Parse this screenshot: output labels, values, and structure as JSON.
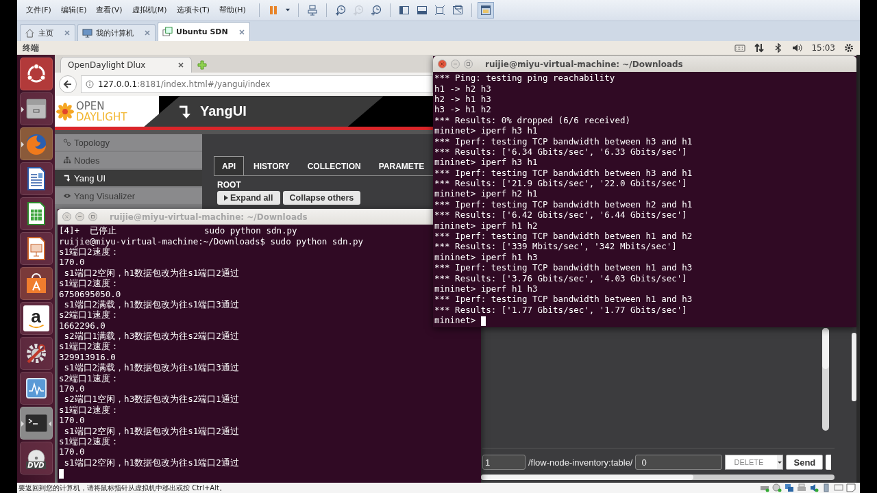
{
  "menu": [
    "文件(F)",
    "编辑(E)",
    "查看(V)",
    "虚拟机(M)",
    "选项卡(T)",
    "帮助(H)"
  ],
  "toolbar_groups": [
    [
      {
        "kind": "pause",
        "pressed": false,
        "disabled": false
      },
      {
        "kind": "caret",
        "pressed": false,
        "disabled": false
      }
    ],
    [
      {
        "kind": "send-keys",
        "pressed": false,
        "disabled": false
      }
    ],
    [
      {
        "kind": "snapshot",
        "pressed": false,
        "disabled": false
      },
      {
        "kind": "snapshot",
        "pressed": false,
        "disabled": true
      },
      {
        "kind": "snapshot",
        "pressed": false,
        "disabled": false
      }
    ],
    [
      {
        "kind": "sidebar-view",
        "pressed": false,
        "disabled": false
      },
      {
        "kind": "console-view",
        "pressed": false,
        "disabled": false
      },
      {
        "kind": "fullscreen",
        "pressed": false,
        "disabled": false
      },
      {
        "kind": "unity",
        "pressed": false,
        "disabled": false
      }
    ],
    [
      {
        "kind": "thumbnail",
        "pressed": true,
        "disabled": false
      }
    ]
  ],
  "vm_tabs": [
    {
      "kind": "home",
      "label": "主页",
      "selected": false
    },
    {
      "kind": "computer",
      "label": "我的计算机",
      "selected": false
    },
    {
      "kind": "vm",
      "label": "Ubuntu SDN",
      "selected": true
    }
  ],
  "top_panel": {
    "app_name": "终端",
    "clock": "15:03"
  },
  "launcher": [
    {
      "kind": "ubuntu",
      "running": false,
      "focused": false
    },
    {
      "kind": "files",
      "running": true,
      "focused": false
    },
    {
      "kind": "firefox",
      "running": true,
      "focused": false
    },
    {
      "kind": "writer",
      "running": false,
      "focused": false
    },
    {
      "kind": "calc",
      "running": false,
      "focused": false
    },
    {
      "kind": "impress",
      "running": false,
      "focused": false
    },
    {
      "kind": "software",
      "running": false,
      "focused": false
    },
    {
      "kind": "amazon",
      "label": "a",
      "running": false,
      "focused": false
    },
    {
      "kind": "settings",
      "running": false,
      "focused": false
    },
    {
      "kind": "monitor",
      "running": false,
      "focused": false
    },
    {
      "kind": "terminal",
      "running": true,
      "focused": true
    },
    {
      "kind": "dvd",
      "label": "DVD",
      "running": false,
      "focused": false
    }
  ],
  "browser": {
    "tab_title": "OpenDaylight Dlux",
    "url_host": "127.0.0.1",
    "url_rest": ":8181/index.html#/yangui/index",
    "logo_top": "OPEN",
    "logo_bottom": "DAYLIGHT",
    "header_title": "YangUI",
    "nav": [
      {
        "kind": "topology",
        "label": "Topology",
        "selected": false
      },
      {
        "kind": "nodes",
        "label": "Nodes",
        "selected": false
      },
      {
        "kind": "yangui",
        "label": "Yang UI",
        "selected": true
      },
      {
        "kind": "visualizer",
        "label": "Yang Visualizer",
        "selected": false
      }
    ],
    "tabs": [
      {
        "label": "API",
        "selected": true
      },
      {
        "label": "HISTORY",
        "selected": false
      },
      {
        "label": "COLLECTION",
        "selected": false
      },
      {
        "label": "PARAMETE",
        "selected": false
      }
    ],
    "root_label": "ROOT",
    "expand_button": "Expand all",
    "collapse_button": "Collapse others",
    "request": {
      "node_value": "1",
      "path_text": "/flow-node-inventory:table/",
      "table_value": "0",
      "method": "DELETE",
      "send_button": "Send"
    }
  },
  "terminals": [
    {
      "title": "ruijie@miyu-virtual-machine: ~/Downloads",
      "focused": false,
      "lines": [
        "[4]+  已停止                 sudo python sdn.py",
        "ruijie@miyu-virtual-machine:~/Downloads$ sudo python sdn.py",
        "s1端口2速度：",
        "170.0",
        " s1端口2空闲，h1数据包改为往s1端口2通过",
        "s1端口2速度：",
        "6750695050.0",
        " s1端口2满载，h1数据包改为往s1端口3通过",
        "s2端口1速度：",
        "1662296.0",
        " s2端口1满载，h3数据包改为往s2端口2通过",
        "s1端口2速度：",
        "329913916.0",
        " s1端口2满载，h1数据包改为往s1端口3通过",
        "s2端口1速度：",
        "170.0",
        " s2端口1空闲，h3数据包改为往s2端口1通过",
        "s1端口2速度：",
        "170.0",
        " s1端口2空闲，h1数据包改为往s1端口2通过",
        "s1端口2速度：",
        "170.0",
        " s1端口2空闲，h1数据包改为往s1端口2通过"
      ]
    },
    {
      "title": "ruijie@miyu-virtual-machine: ~/Downloads",
      "focused": true,
      "prompt": "mininet>",
      "lines": [
        "*** Ping: testing ping reachability",
        "h1 -> h2 h3",
        "h2 -> h1 h3",
        "h3 -> h1 h2",
        "*** Results: 0% dropped (6/6 received)",
        "mininet> iperf h3 h1",
        "*** Iperf: testing TCP bandwidth between h3 and h1",
        "*** Results: ['6.34 Gbits/sec', '6.33 Gbits/sec']",
        "mininet> iperf h3 h1",
        "*** Iperf: testing TCP bandwidth between h3 and h1",
        "*** Results: ['21.9 Gbits/sec', '22.0 Gbits/sec']",
        "mininet> iperf h2 h1",
        "*** Iperf: testing TCP bandwidth between h2 and h1",
        "*** Results: ['6.42 Gbits/sec', '6.44 Gbits/sec']",
        "mininet> iperf h1 h2",
        "*** Iperf: testing TCP bandwidth between h1 and h2",
        "*** Results: ['339 Mbits/sec', '342 Mbits/sec']",
        "mininet> iperf h1 h3",
        "*** Iperf: testing TCP bandwidth between h1 and h3",
        "*** Results: ['3.76 Gbits/sec', '4.03 Gbits/sec']",
        "mininet> iperf h1 h3",
        "*** Iperf: testing TCP bandwidth between h1 and h3",
        "*** Results: ['1.77 Gbits/sec', '1.77 Gbits/sec']"
      ]
    }
  ],
  "status_bar": {
    "message": "要返回到您的计算机，请将鼠标指针从虚拟机中移出或按 Ctrl+Alt。"
  }
}
